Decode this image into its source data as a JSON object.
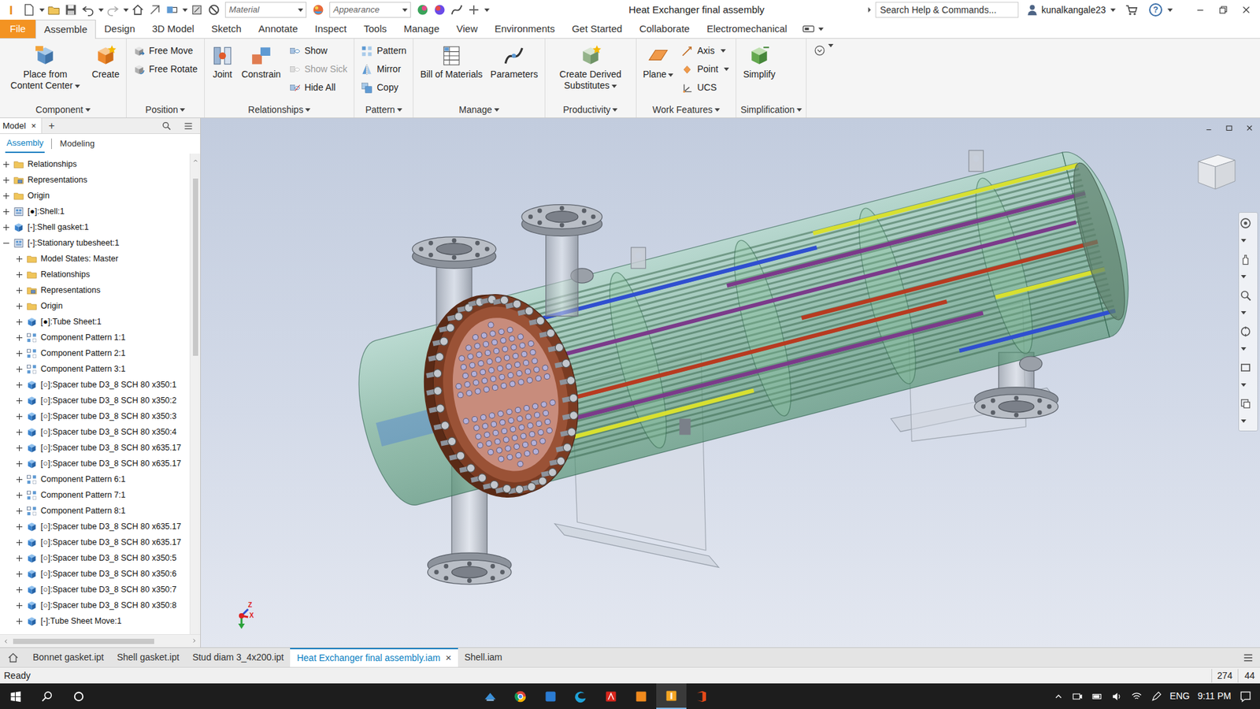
{
  "window": {
    "app_icon": "I",
    "title": "Heat Exchanger final assembly",
    "search_placeholder": "Search Help & Commands...",
    "user": "kunalkangale23",
    "help": "?"
  },
  "quick_access": {
    "material": "Material",
    "appearance": "Appearance"
  },
  "ribbon_tabs": [
    {
      "label": "File",
      "selected": false
    },
    {
      "label": "Assemble",
      "selected": true
    },
    {
      "label": "Design",
      "selected": false
    },
    {
      "label": "3D Model",
      "selected": false
    },
    {
      "label": "Sketch",
      "selected": false
    },
    {
      "label": "Annotate",
      "selected": false
    },
    {
      "label": "Inspect",
      "selected": false
    },
    {
      "label": "Tools",
      "selected": false
    },
    {
      "label": "Manage",
      "selected": false
    },
    {
      "label": "View",
      "selected": false
    },
    {
      "label": "Environments",
      "selected": false
    },
    {
      "label": "Get Started",
      "selected": false
    },
    {
      "label": "Collaborate",
      "selected": false
    },
    {
      "label": "Electromechanical",
      "selected": false
    }
  ],
  "ribbon_panels": [
    {
      "title": "Component",
      "items": [
        {
          "kind": "large",
          "label": "Place from Content Center",
          "disabled": false,
          "dropdown": true
        },
        {
          "kind": "large",
          "label": "Create",
          "disabled": false,
          "dropdown": false
        }
      ]
    },
    {
      "title": "Position",
      "items": [
        {
          "kind": "stack",
          "buttons": [
            {
              "label": "Free Move",
              "disabled": false,
              "dropdown": false
            },
            {
              "label": "Free Rotate",
              "disabled": false,
              "dropdown": false
            }
          ]
        }
      ]
    },
    {
      "title": "Relationships",
      "items": [
        {
          "kind": "large",
          "label": "Joint",
          "disabled": false,
          "dropdown": false
        },
        {
          "kind": "large",
          "label": "Constrain",
          "disabled": false,
          "dropdown": false
        },
        {
          "kind": "stack",
          "buttons": [
            {
              "label": "Show",
              "disabled": false,
              "dropdown": false
            },
            {
              "label": "Show Sick",
              "disabled": true,
              "dropdown": false
            },
            {
              "label": "Hide All",
              "disabled": false,
              "dropdown": false
            }
          ]
        }
      ]
    },
    {
      "title": "Pattern",
      "items": [
        {
          "kind": "stack",
          "buttons": [
            {
              "label": "Pattern",
              "disabled": false,
              "dropdown": false
            },
            {
              "label": "Mirror",
              "disabled": false,
              "dropdown": false
            },
            {
              "label": "Copy",
              "disabled": false,
              "dropdown": false
            }
          ]
        }
      ]
    },
    {
      "title": "Manage",
      "items": [
        {
          "kind": "large",
          "label": "Bill of Materials",
          "disabled": false,
          "dropdown": false
        },
        {
          "kind": "large",
          "label": "Parameters",
          "disabled": false,
          "dropdown": false
        }
      ]
    },
    {
      "title": "Productivity",
      "items": [
        {
          "kind": "large",
          "label": "Create Derived Substitutes",
          "disabled": false,
          "dropdown": true
        }
      ]
    },
    {
      "title": "Work Features",
      "items": [
        {
          "kind": "large",
          "label": "Plane",
          "disabled": false,
          "dropdown": true
        },
        {
          "kind": "stack",
          "buttons": [
            {
              "label": "Axis",
              "disabled": false,
              "dropdown": true
            },
            {
              "label": "Point",
              "disabled": false,
              "dropdown": true
            },
            {
              "label": "UCS",
              "disabled": false,
              "dropdown": false
            }
          ]
        }
      ]
    },
    {
      "title": "Simplification",
      "items": [
        {
          "kind": "large",
          "label": "Simplify",
          "disabled": false,
          "dropdown": false
        }
      ]
    }
  ],
  "browser": {
    "tab": "Model",
    "close": "×",
    "add": "+",
    "subtabs": [
      {
        "label": "Assembly",
        "selected": true
      },
      {
        "label": "Modeling",
        "selected": false
      }
    ],
    "items": [
      {
        "label": "Relationships",
        "kind": "folder",
        "expanded": false
      },
      {
        "label": "Representations",
        "kind": "representations",
        "expanded": false
      },
      {
        "label": "Origin",
        "kind": "folder",
        "expanded": false
      },
      {
        "label": "[●]:Shell:1",
        "kind": "assembly",
        "expanded": false
      },
      {
        "label": "[-]:Shell gasket:1",
        "kind": "part",
        "expanded": false
      },
      {
        "label": "[-]:Stationary tubesheet:1",
        "kind": "assembly",
        "expanded": true,
        "children": [
          {
            "label": "Model States: Master",
            "kind": "folder",
            "expanded": false
          },
          {
            "label": "Relationships",
            "kind": "folder",
            "expanded": false
          },
          {
            "label": "Representations",
            "kind": "representations",
            "expanded": false
          },
          {
            "label": "Origin",
            "kind": "folder",
            "expanded": false
          },
          {
            "label": "[●]:Tube Sheet:1",
            "kind": "part",
            "expanded": false
          },
          {
            "label": "Component Pattern 1:1",
            "kind": "pattern",
            "expanded": false
          },
          {
            "label": "Component Pattern 2:1",
            "kind": "pattern",
            "expanded": false
          },
          {
            "label": "Component Pattern 3:1",
            "kind": "pattern",
            "expanded": false
          },
          {
            "label": "[○]:Spacer tube D3_8 SCH 80 x350:1",
            "kind": "part",
            "expanded": false
          },
          {
            "label": "[○]:Spacer tube D3_8 SCH 80 x350:2",
            "kind": "part",
            "expanded": false
          },
          {
            "label": "[○]:Spacer tube D3_8 SCH 80 x350:3",
            "kind": "part",
            "expanded": false
          },
          {
            "label": "[○]:Spacer tube D3_8 SCH 80 x350:4",
            "kind": "part",
            "expanded": false
          },
          {
            "label": "[○]:Spacer tube D3_8 SCH 80 x635.17",
            "kind": "part",
            "expanded": false
          },
          {
            "label": "[○]:Spacer tube D3_8 SCH 80 x635.17",
            "kind": "part",
            "expanded": false
          },
          {
            "label": "Component Pattern 6:1",
            "kind": "pattern",
            "expanded": false
          },
          {
            "label": "Component Pattern 7:1",
            "kind": "pattern",
            "expanded": false
          },
          {
            "label": "Component Pattern 8:1",
            "kind": "pattern",
            "expanded": false
          },
          {
            "label": "[○]:Spacer tube D3_8 SCH 80 x635.17",
            "kind": "part",
            "expanded": false
          },
          {
            "label": "[○]:Spacer tube D3_8 SCH 80 x635.17",
            "kind": "part",
            "expanded": false
          },
          {
            "label": "[○]:Spacer tube D3_8 SCH 80 x350:5",
            "kind": "part",
            "expanded": false
          },
          {
            "label": "[○]:Spacer tube D3_8 SCH 80 x350:6",
            "kind": "part",
            "expanded": false
          },
          {
            "label": "[○]:Spacer tube D3_8 SCH 80 x350:7",
            "kind": "part",
            "expanded": false
          },
          {
            "label": "[○]:Spacer tube D3_8 SCH 80 x350:8",
            "kind": "part",
            "expanded": false
          },
          {
            "label": "[-]:Tube Sheet Move:1",
            "kind": "part",
            "expanded": false
          }
        ]
      }
    ]
  },
  "viewport": {
    "triad": {
      "z": "Z",
      "x": "X"
    }
  },
  "document_tabs": {
    "close": "×",
    "tabs": [
      {
        "label": "Bonnet gasket.ipt",
        "selected": false,
        "closable": false
      },
      {
        "label": "Shell gasket.ipt",
        "selected": false,
        "closable": false
      },
      {
        "label": "Stud diam 3_4x200.ipt",
        "selected": false,
        "closable": false
      },
      {
        "label": "Heat Exchanger final assembly.iam",
        "selected": true,
        "closable": true
      },
      {
        "label": "Shell.iam",
        "selected": false,
        "closable": false
      }
    ]
  },
  "status_bar": {
    "text": "Ready",
    "readings": [
      "274",
      "44"
    ]
  },
  "taskbar": {
    "language": "ENG",
    "time": "9:11 PM"
  }
}
